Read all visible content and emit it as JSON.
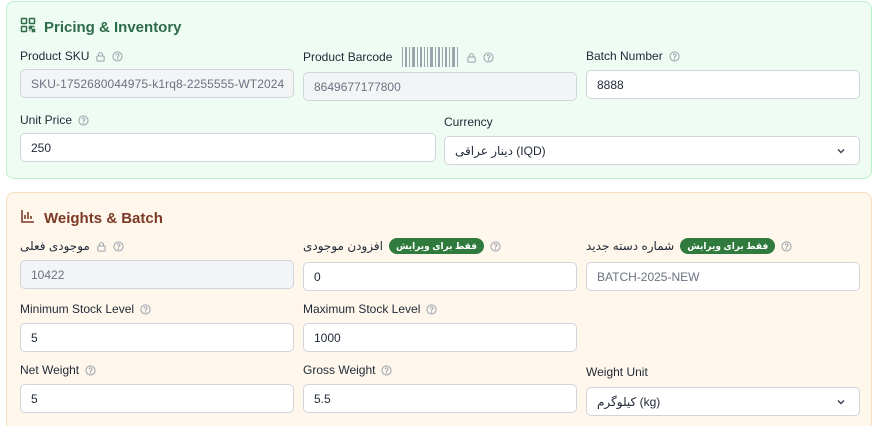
{
  "pricing": {
    "title": "Pricing & Inventory",
    "product_sku": {
      "label": "Product SKU",
      "value": "SKU-1752680044975-k1rq8-2255555-WT2024"
    },
    "product_barcode": {
      "label": "Product Barcode",
      "value": "8649677177800"
    },
    "batch_number": {
      "label": "Batch Number",
      "value": "8888"
    },
    "unit_price": {
      "label": "Unit Price",
      "value": "250"
    },
    "currency": {
      "label": "Currency",
      "value": "دینار عراقی (IQD)"
    }
  },
  "weights": {
    "title": "Weights & Batch",
    "current_stock": {
      "label": "موجودی فعلی",
      "value": "10422"
    },
    "add_stock": {
      "label": "افزودن موجودی",
      "badge": "فقط برای ویرایش",
      "value": "0"
    },
    "new_batch": {
      "label": "شماره دسته جدید",
      "badge": "فقط برای ویرایش",
      "placeholder": "BATCH-2025-NEW"
    },
    "min_stock": {
      "label": "Minimum Stock Level",
      "value": "5"
    },
    "max_stock": {
      "label": "Maximum Stock Level",
      "value": "1000"
    },
    "net_weight": {
      "label": "Net Weight",
      "value": "5"
    },
    "gross_weight": {
      "label": "Gross Weight",
      "value": "5.5"
    },
    "weight_unit": {
      "label": "Weight Unit",
      "value": "کیلوگرم (kg)"
    }
  },
  "icons": {
    "pricing_title": "qr-code-icon",
    "weights_title": "bar-chart-icon",
    "lock": "lock-icon",
    "help": "help-circle-icon",
    "barcode": "barcode-icon",
    "select": "chevron-down-icon"
  },
  "colors": {
    "pricing_bg": "#eefcf3",
    "pricing_title": "#2e6b4a",
    "weights_bg": "#fff7ec",
    "weights_title": "#7c3a26",
    "badge": "#2f7a3c"
  }
}
